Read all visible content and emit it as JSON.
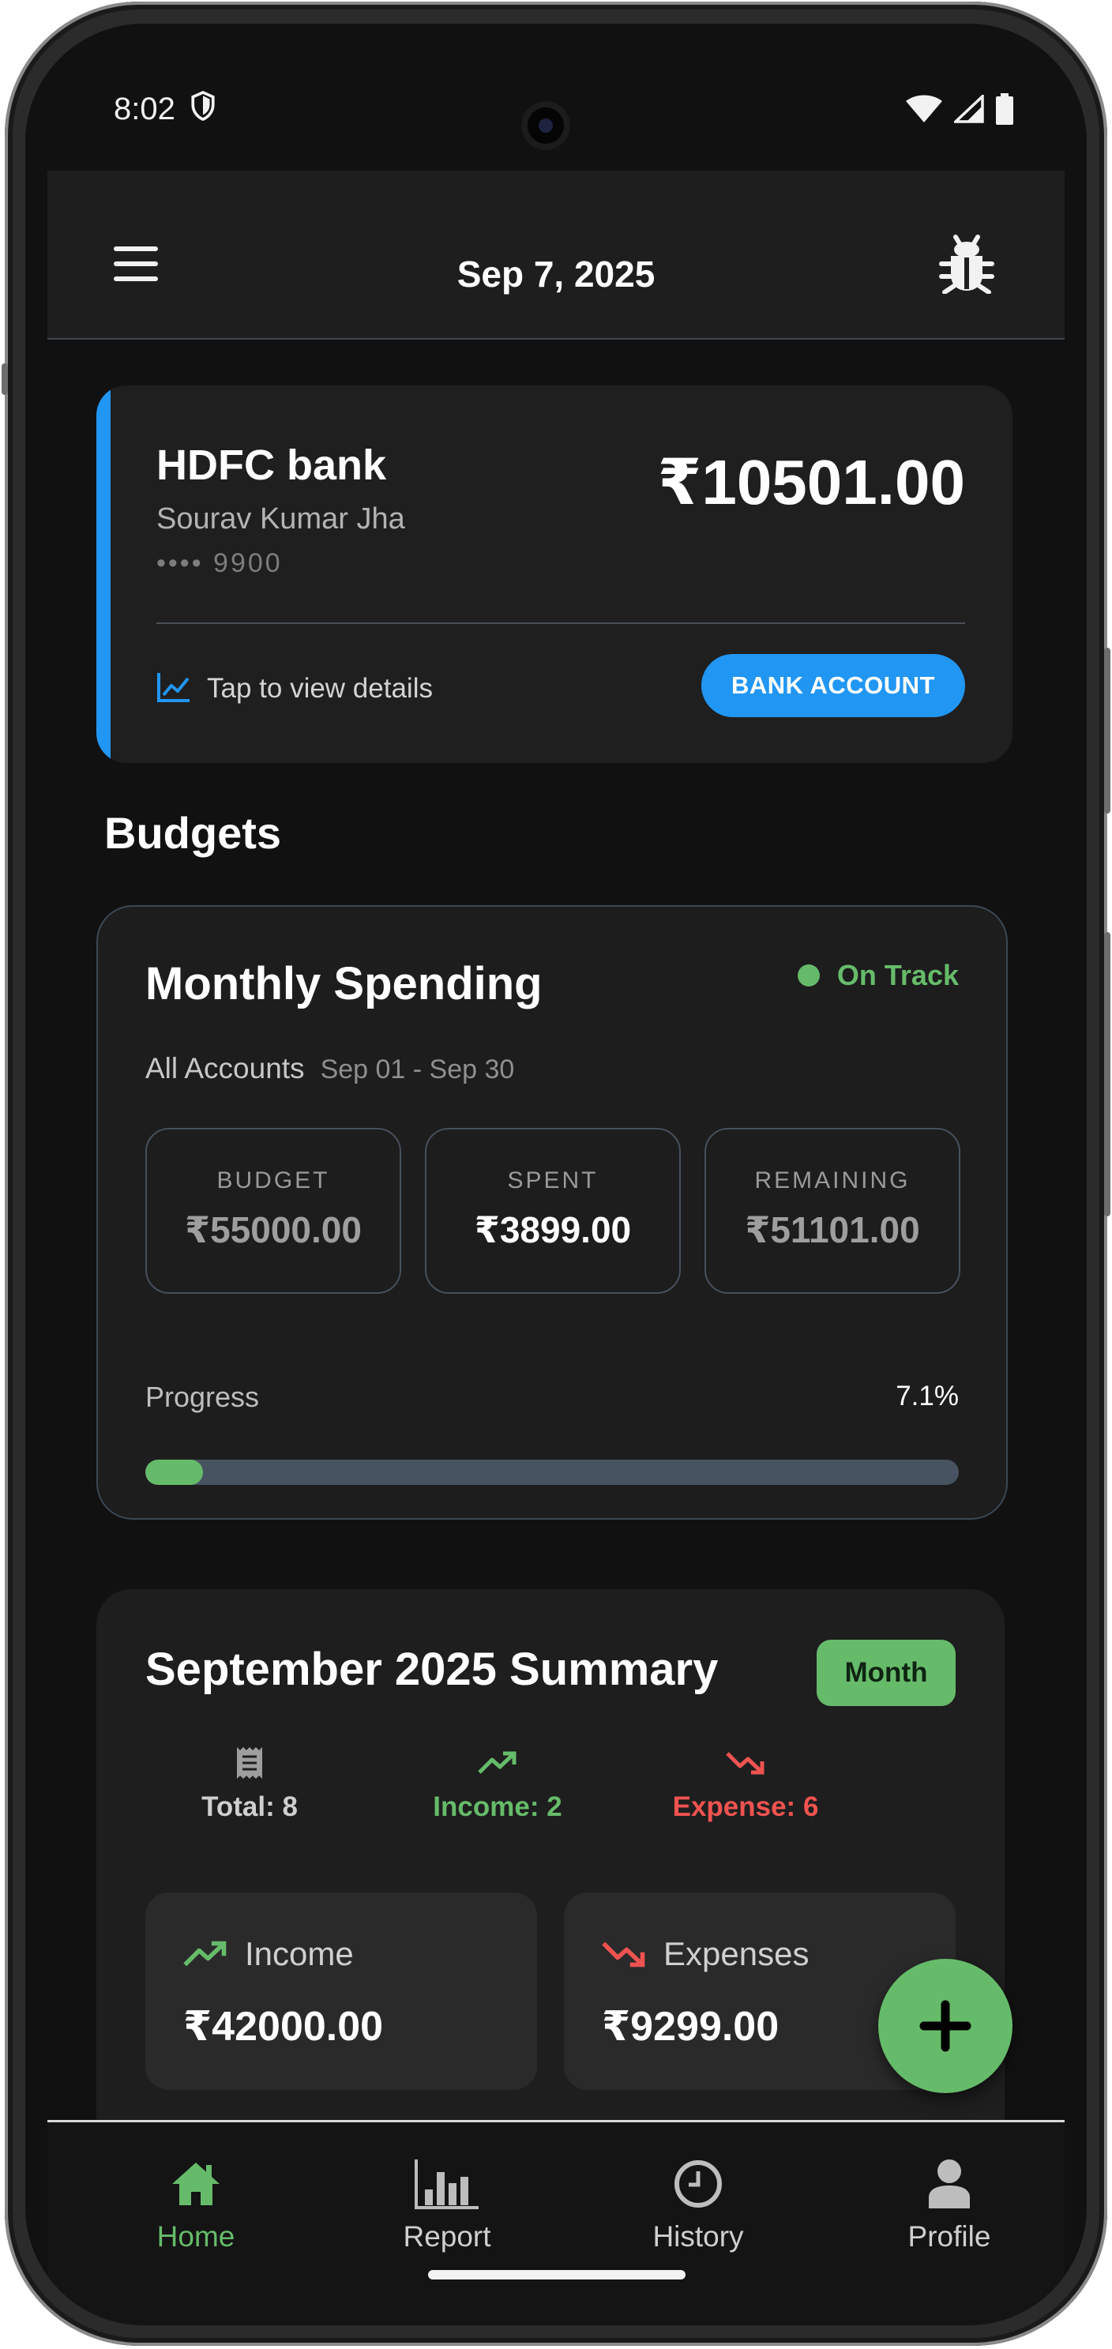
{
  "status_bar": {
    "time": "8:02"
  },
  "app_bar": {
    "title": "Sep 7, 2025"
  },
  "account": {
    "bank_name": "HDFC bank",
    "holder": "Sourav Kumar Jha",
    "masked_number": "•••• 9900",
    "balance": "₹10501.00",
    "tap_text": "Tap to view details",
    "button_label": "BANK ACCOUNT",
    "accent_color": "#2196f3"
  },
  "budgets": {
    "section_title": "Budgets",
    "name": "Monthly Spending",
    "status": "On Track",
    "accounts": "All Accounts",
    "date_range": "Sep 01 - Sep 30",
    "stats": [
      {
        "label": "BUDGET",
        "value": "₹55000.00"
      },
      {
        "label": "SPENT",
        "value": "₹3899.00"
      },
      {
        "label": "REMAINING",
        "value": "₹51101.00"
      }
    ],
    "progress_label": "Progress",
    "progress_text": "7.1%",
    "progress_fraction": 0.071,
    "status_color": "#66bb6a"
  },
  "summary": {
    "title": "September 2025 Summary",
    "period_button": "Month",
    "counts": [
      {
        "icon": "receipt-icon",
        "text": "Total: 8"
      },
      {
        "icon": "trending-up-icon",
        "text": "Income: 2"
      },
      {
        "icon": "trending-down-icon",
        "text": "Expense: 6"
      }
    ],
    "income": {
      "label": "Income",
      "amount": "₹42000.00",
      "icon": "trending-up-icon"
    },
    "expenses": {
      "label": "Expenses",
      "amount": "₹9299.00",
      "icon": "trending-down-icon"
    },
    "income_color": "#66bb6a",
    "expense_color": "#ef5350"
  },
  "fab": {
    "icon": "plus-icon"
  },
  "bottom_nav": {
    "items": [
      {
        "label": "Home",
        "icon": "home-icon",
        "active": true
      },
      {
        "label": "Report",
        "icon": "bar-chart-icon",
        "active": false
      },
      {
        "label": "History",
        "icon": "clock-icon",
        "active": false
      },
      {
        "label": "Profile",
        "icon": "person-icon",
        "active": false
      }
    ]
  }
}
